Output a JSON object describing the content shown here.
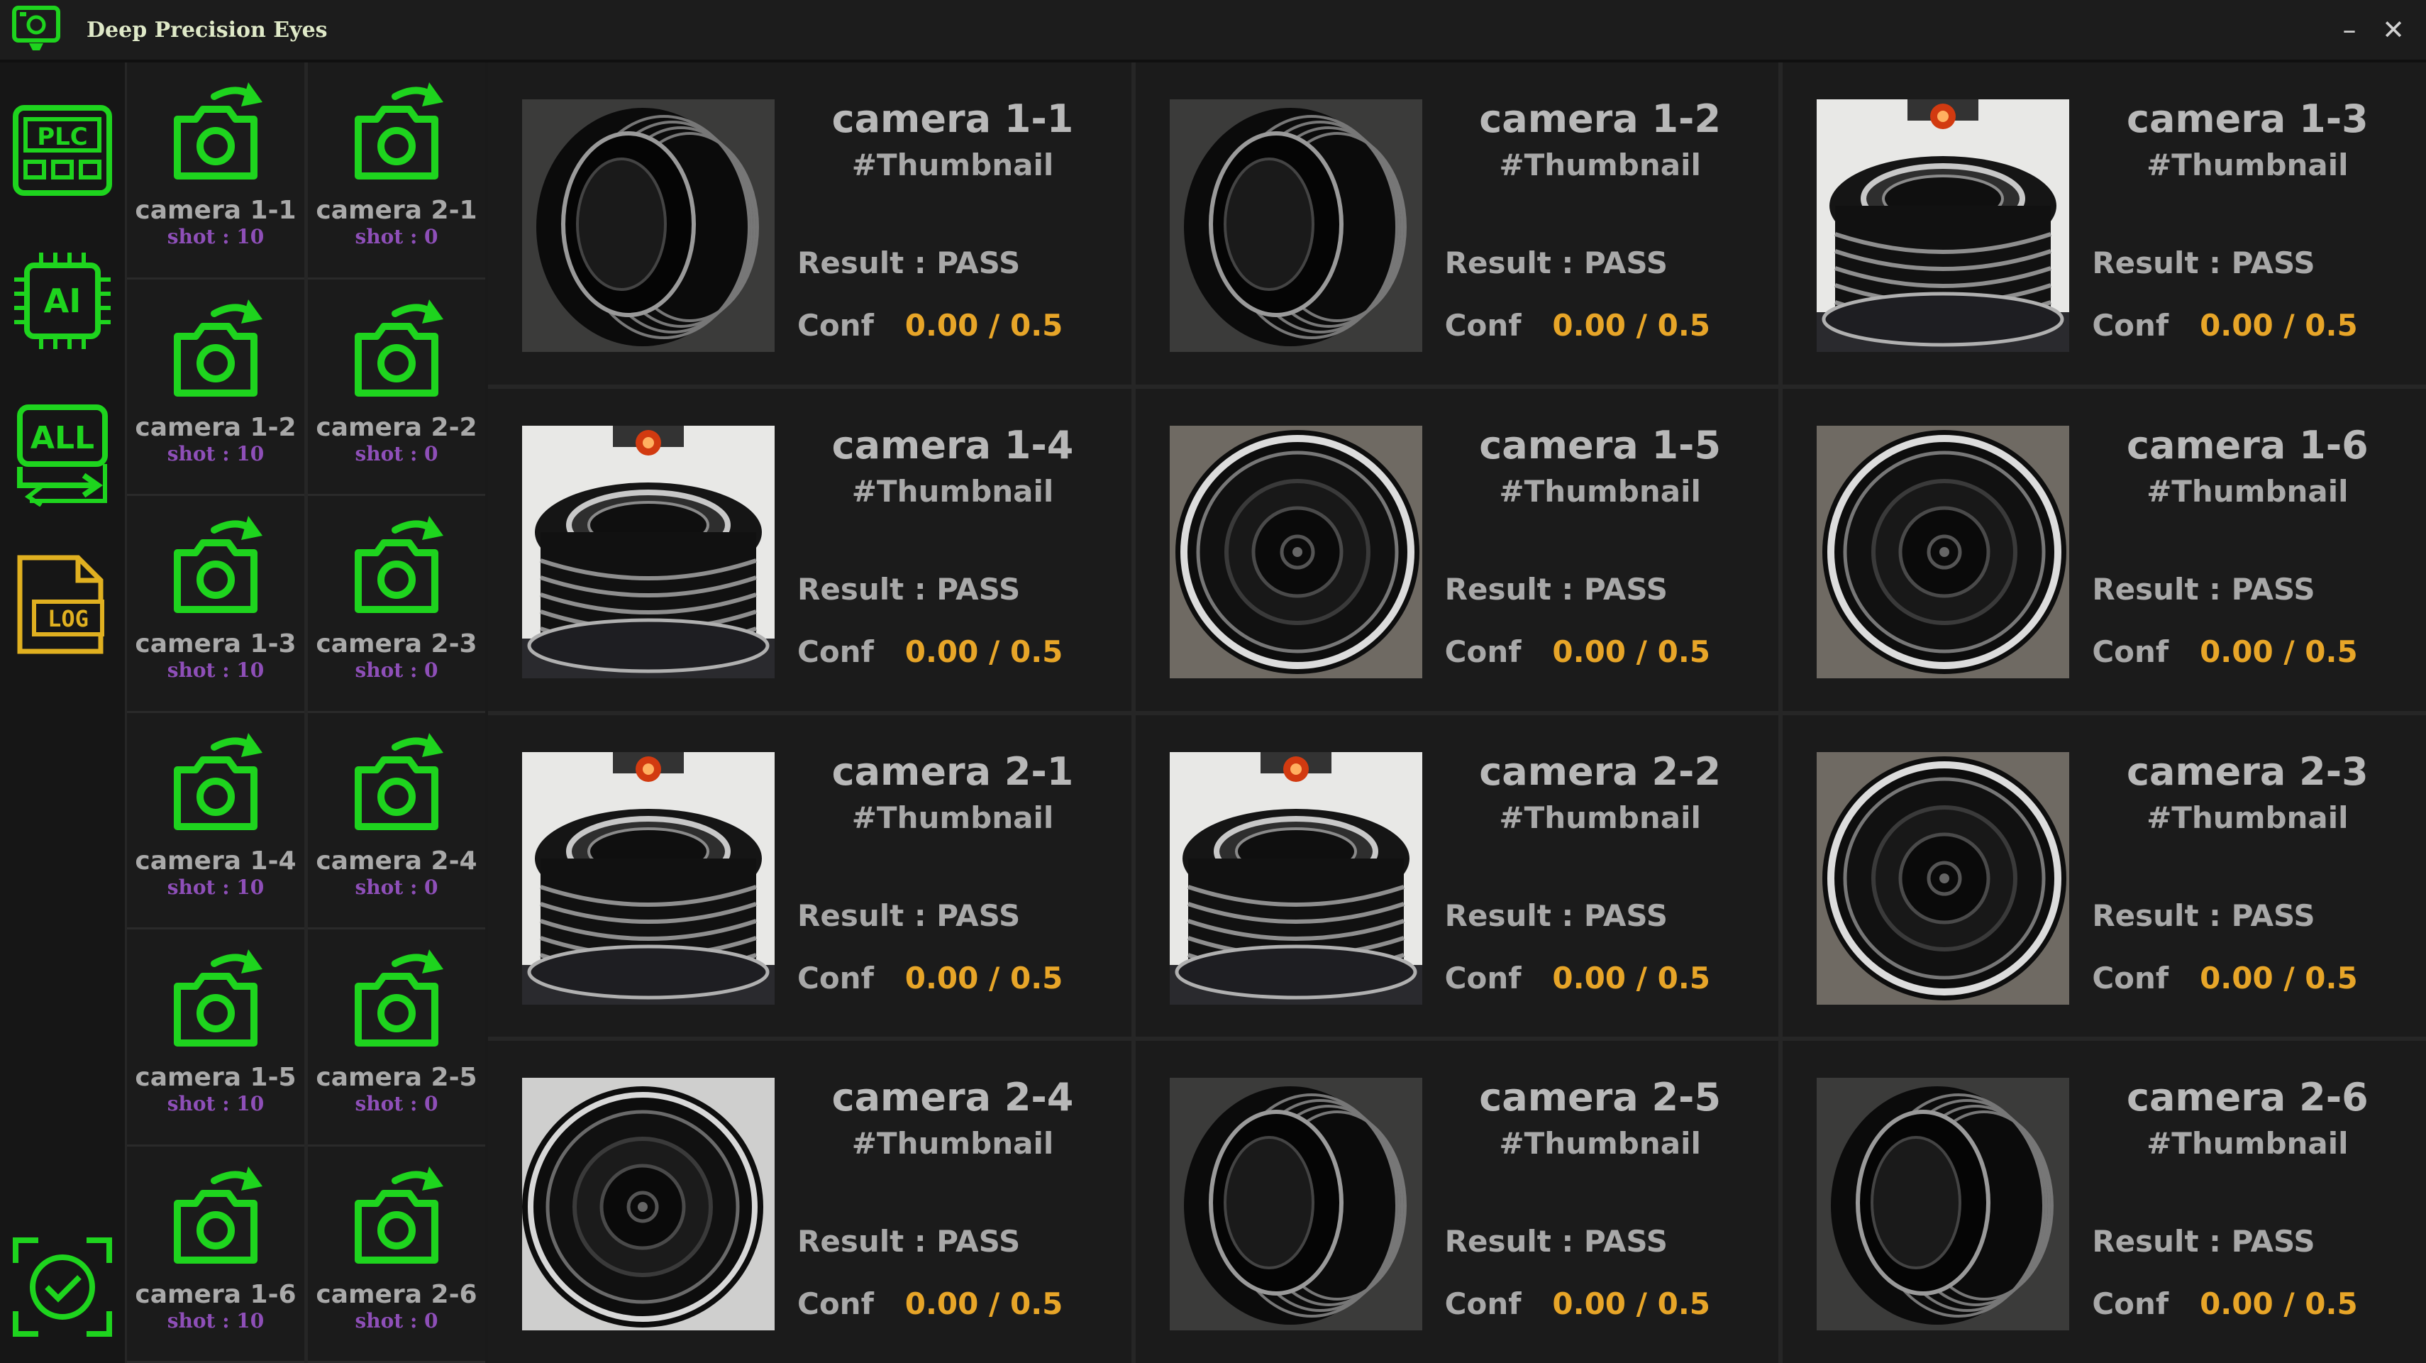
{
  "app": {
    "title": "Deep Precision Eyes",
    "minimize": "–",
    "close": "✕"
  },
  "nav": [
    {
      "name": "plc",
      "icon": "plc-icon",
      "label": "PLC"
    },
    {
      "name": "ai",
      "icon": "ai-chip-icon",
      "label": "AI"
    },
    {
      "name": "all",
      "icon": "all-cameras-icon",
      "label": "ALL"
    },
    {
      "name": "log",
      "icon": "log-file-icon",
      "label": "LOG"
    },
    {
      "name": "inspect",
      "icon": "check-scan-icon",
      "label": ""
    }
  ],
  "cameras": [
    {
      "name": "camera 1-1",
      "shot": "shot : 10"
    },
    {
      "name": "camera 2-1",
      "shot": "shot : 0"
    },
    {
      "name": "camera 1-2",
      "shot": "shot : 10"
    },
    {
      "name": "camera 2-2",
      "shot": "shot : 0"
    },
    {
      "name": "camera 1-3",
      "shot": "shot : 10"
    },
    {
      "name": "camera 2-3",
      "shot": "shot : 0"
    },
    {
      "name": "camera 1-4",
      "shot": "shot : 10"
    },
    {
      "name": "camera 2-4",
      "shot": "shot : 0"
    },
    {
      "name": "camera 1-5",
      "shot": "shot : 10"
    },
    {
      "name": "camera 2-5",
      "shot": "shot : 0"
    },
    {
      "name": "camera 1-6",
      "shot": "shot : 10"
    },
    {
      "name": "camera 2-6",
      "shot": "shot : 0"
    }
  ],
  "results": [
    {
      "title": "camera 1-1",
      "sub": "#Thumbnail",
      "result": "Result : PASS",
      "conf_label": "Conf",
      "conf_value": "0.00",
      "conf_sep": "/",
      "conf_threshold": "0.5",
      "thumb": "pulley-angled"
    },
    {
      "title": "camera 1-2",
      "sub": "#Thumbnail",
      "result": "Result : PASS",
      "conf_label": "Conf",
      "conf_value": "0.00",
      "conf_sep": "/",
      "conf_threshold": "0.5",
      "thumb": "pulley-angled"
    },
    {
      "title": "camera 1-3",
      "sub": "#Thumbnail",
      "result": "Result : PASS",
      "conf_label": "Conf",
      "conf_value": "0.00",
      "conf_sep": "/",
      "conf_threshold": "0.5",
      "thumb": "pulley-side-lamp"
    },
    {
      "title": "camera 1-4",
      "sub": "#Thumbnail",
      "result": "Result : PASS",
      "conf_label": "Conf",
      "conf_value": "0.00",
      "conf_sep": "/",
      "conf_threshold": "0.5",
      "thumb": "pulley-side-lamp"
    },
    {
      "title": "camera 1-5",
      "sub": "#Thumbnail",
      "result": "Result : PASS",
      "conf_label": "Conf",
      "conf_value": "0.00",
      "conf_sep": "/",
      "conf_threshold": "0.5",
      "thumb": "pulley-top"
    },
    {
      "title": "camera 1-6",
      "sub": "#Thumbnail",
      "result": "Result : PASS",
      "conf_label": "Conf",
      "conf_value": "0.00",
      "conf_sep": "/",
      "conf_threshold": "0.5",
      "thumb": "pulley-top"
    },
    {
      "title": "camera 2-1",
      "sub": "#Thumbnail",
      "result": "Result : PASS",
      "conf_label": "Conf",
      "conf_value": "0.00",
      "conf_sep": "/",
      "conf_threshold": "0.5",
      "thumb": "pulley-side-lamp"
    },
    {
      "title": "camera 2-2",
      "sub": "#Thumbnail",
      "result": "Result : PASS",
      "conf_label": "Conf",
      "conf_value": "0.00",
      "conf_sep": "/",
      "conf_threshold": "0.5",
      "thumb": "pulley-side-lamp"
    },
    {
      "title": "camera 2-3",
      "sub": "#Thumbnail",
      "result": "Result : PASS",
      "conf_label": "Conf",
      "conf_value": "0.00",
      "conf_sep": "/",
      "conf_threshold": "0.5",
      "thumb": "pulley-top"
    },
    {
      "title": "camera 2-4",
      "sub": "#Thumbnail",
      "result": "Result : PASS",
      "conf_label": "Conf",
      "conf_value": "0.00",
      "conf_sep": "/",
      "conf_threshold": "0.5",
      "thumb": "pulley-top-light"
    },
    {
      "title": "camera 2-5",
      "sub": "#Thumbnail",
      "result": "Result : PASS",
      "conf_label": "Conf",
      "conf_value": "0.00",
      "conf_sep": "/",
      "conf_threshold": "0.5",
      "thumb": "pulley-angled"
    },
    {
      "title": "camera 2-6",
      "sub": "#Thumbnail",
      "result": "Result : PASS",
      "conf_label": "Conf",
      "conf_value": "0.00",
      "conf_sep": "/",
      "conf_threshold": "0.5",
      "thumb": "pulley-angled"
    }
  ],
  "colors": {
    "accent_green": "#1ed41e",
    "conf_value": "#e7a528",
    "shot_text": "#8e4fb8",
    "log_icon": "#e0b020"
  }
}
